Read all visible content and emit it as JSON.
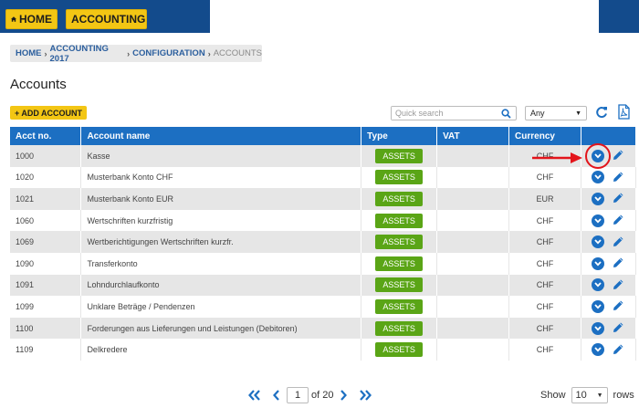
{
  "nav": {
    "home_label": "HOME",
    "accounting_label": "ACCOUNTING"
  },
  "breadcrumb": {
    "items": [
      "HOME",
      "ACCOUNTING 2017",
      "CONFIGURATION"
    ],
    "current": "ACCOUNTS"
  },
  "page": {
    "title": "Accounts"
  },
  "toolbar": {
    "add_label": "+ ADD ACCOUNT",
    "search_placeholder": "Quick search",
    "filter_value": "Any"
  },
  "table": {
    "headers": [
      "Acct no.",
      "Account name",
      "Type",
      "VAT",
      "Currency"
    ],
    "rows": [
      {
        "no": "1000",
        "name": "Kasse",
        "type": "ASSETS",
        "vat": "",
        "currency": "CHF"
      },
      {
        "no": "1020",
        "name": "Musterbank Konto CHF",
        "type": "ASSETS",
        "vat": "",
        "currency": "CHF"
      },
      {
        "no": "1021",
        "name": "Musterbank Konto EUR",
        "type": "ASSETS",
        "vat": "",
        "currency": "EUR"
      },
      {
        "no": "1060",
        "name": "Wertschriften kurzfristig",
        "type": "ASSETS",
        "vat": "",
        "currency": "CHF"
      },
      {
        "no": "1069",
        "name": "Wertberichtigungen Wertschriften kurzfr.",
        "type": "ASSETS",
        "vat": "",
        "currency": "CHF"
      },
      {
        "no": "1090",
        "name": "Transferkonto",
        "type": "ASSETS",
        "vat": "",
        "currency": "CHF"
      },
      {
        "no": "1091",
        "name": "Lohndurchlaufkonto",
        "type": "ASSETS",
        "vat": "",
        "currency": "CHF"
      },
      {
        "no": "1099",
        "name": "Unklare Beträge / Pendenzen",
        "type": "ASSETS",
        "vat": "",
        "currency": "CHF"
      },
      {
        "no": "1100",
        "name": "Forderungen aus Lieferungen und Leistungen (Debitoren)",
        "type": "ASSETS",
        "vat": "",
        "currency": "CHF"
      },
      {
        "no": "1109",
        "name": "Delkredere",
        "type": "ASSETS",
        "vat": "",
        "currency": "CHF"
      }
    ]
  },
  "pagination": {
    "page": "1",
    "of_label": "of 20"
  },
  "rows_selector": {
    "show_label": "Show",
    "value": "10",
    "rows_label": "rows"
  },
  "colors": {
    "navy": "#134b8c",
    "accent_blue": "#1c6fc2",
    "yellow": "#f3c614",
    "badge_green": "#5aa516",
    "annotation_red": "#e3141b"
  },
  "icons": [
    "home-icon",
    "chevron-down-icon",
    "search-icon",
    "refresh-icon",
    "pdf-icon",
    "expand-chevron-icon",
    "pencil-icon",
    "first-page-icon",
    "prev-page-icon",
    "next-page-icon",
    "last-page-icon"
  ]
}
